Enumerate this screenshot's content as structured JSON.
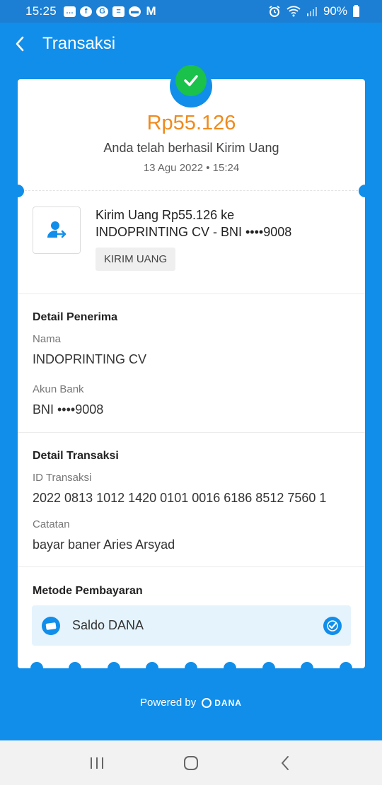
{
  "status_bar": {
    "time": "15:25",
    "battery": "90%",
    "left_icons": [
      "message-icon",
      "facebook-icon",
      "g-icon",
      "news-icon",
      "chat-icon",
      "gmail-icon"
    ],
    "right_icons": [
      "alarm-icon",
      "wifi-icon",
      "signal-icon",
      "battery-icon"
    ]
  },
  "header": {
    "title": "Transaksi"
  },
  "receipt": {
    "amount": "Rp55.126",
    "status_text": "Anda telah berhasil Kirim Uang",
    "timestamp": "13 Agu 2022 • 15:24",
    "description_line1": "Kirim Uang Rp55.126 ke",
    "description_line2": "INDOPRINTING CV - BNI ••••9008",
    "badge": "KIRIM UANG"
  },
  "recipient": {
    "section_title": "Detail Penerima",
    "name_label": "Nama",
    "name_value": "INDOPRINTING CV",
    "bank_label": "Akun Bank",
    "bank_value": "BNI ••••9008"
  },
  "transaction": {
    "section_title": "Detail Transaksi",
    "id_label": "ID Transaksi",
    "id_value": "2022 0813 1012 1420 0101 0016 6186 8512 7560 1",
    "note_label": "Catatan",
    "note_value": "bayar baner Aries Arsyad"
  },
  "payment": {
    "section_title": "Metode Pembayaran",
    "method": "Saldo DANA"
  },
  "footer": {
    "powered_by": "Powered by",
    "brand": "DANA"
  },
  "colors": {
    "primary": "#118EEA",
    "amount": "#F08A1C",
    "success": "#1AC14A"
  }
}
